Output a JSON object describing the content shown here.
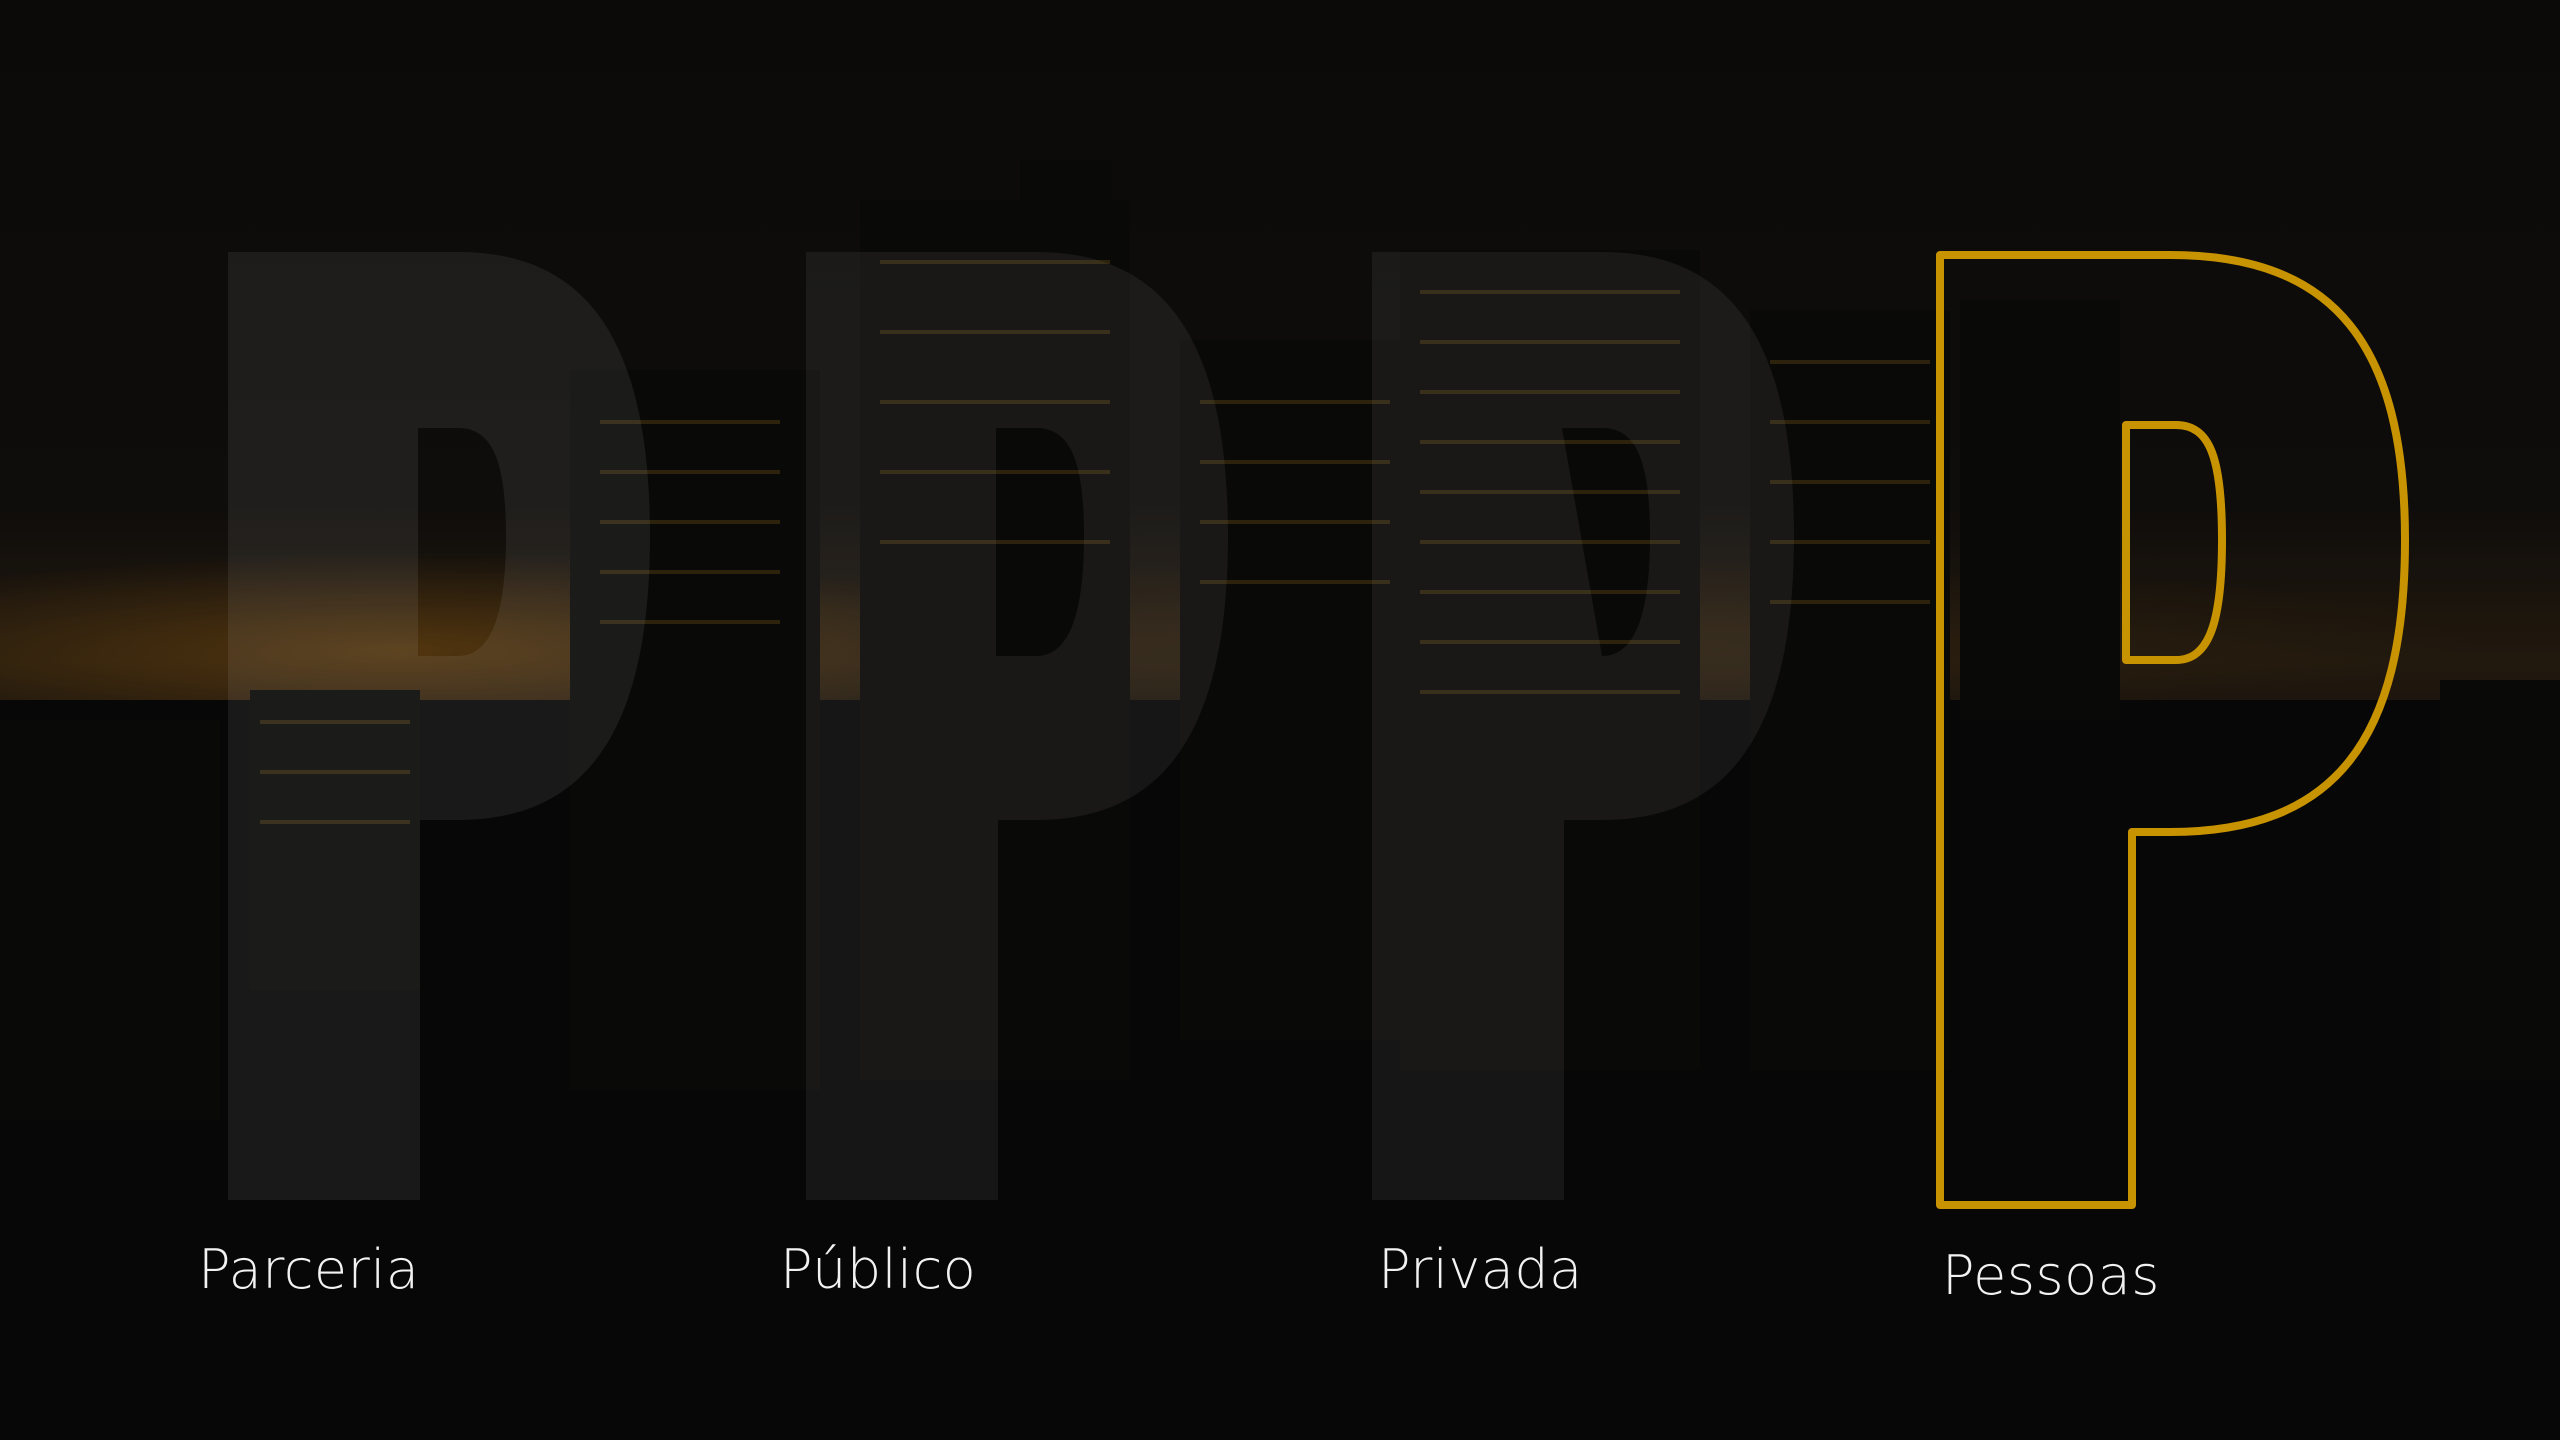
{
  "slide": {
    "letters": [
      "P",
      "P",
      "P",
      "P"
    ],
    "words": [
      "Parceria",
      "Público",
      "Privada",
      "Pessoas"
    ],
    "highlighted_index": 3
  },
  "colors": {
    "accent": "#f5b400",
    "ghost_letter": "#ffffff",
    "label_text": "#f2f2f2",
    "background": "#0b0a09"
  },
  "background_image": "night-city-skyline"
}
